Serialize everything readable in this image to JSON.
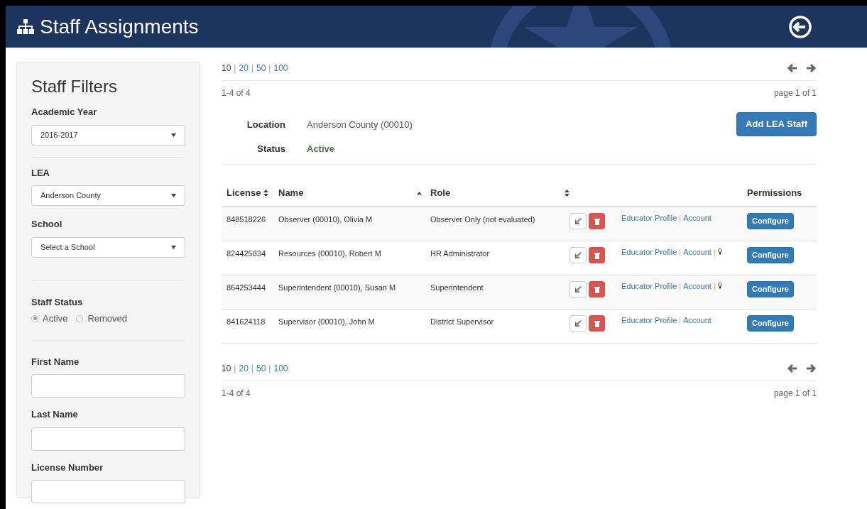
{
  "header": {
    "title": "Staff Assignments"
  },
  "filters": {
    "title": "Staff Filters",
    "selects": [
      {
        "label": "Academic Year",
        "value": "2016-2017",
        "divider": true
      },
      {
        "label": "LEA",
        "value": "Anderson County",
        "divider": false
      },
      {
        "label": "School",
        "value": "Select a School",
        "divider": true
      }
    ],
    "status": {
      "label": "Staff Status",
      "options": [
        {
          "label": "Active",
          "selected": true
        },
        {
          "label": "Removed",
          "selected": false
        }
      ]
    },
    "fields": [
      {
        "label": "First Name"
      },
      {
        "label": "Last Name"
      },
      {
        "label": "License Number"
      }
    ]
  },
  "pager_top": {
    "separator": "|",
    "sizes": [
      {
        "label": "10",
        "selected": true
      },
      {
        "label": "20",
        "selected": false
      },
      {
        "label": "50",
        "selected": false
      },
      {
        "label": "100",
        "selected": false
      }
    ],
    "range": "1-4 of 4",
    "page": "page 1 of 1"
  },
  "info": [
    {
      "label": "Location",
      "value": "Anderson County (00010)",
      "kind": "plain"
    },
    {
      "label": "Status",
      "value": "Active",
      "kind": "status"
    }
  ],
  "add_button": "Add LEA Staff",
  "table": {
    "columns": [
      {
        "label": "License",
        "kind": "both"
      },
      {
        "label": "Name",
        "kind": "asc"
      },
      {
        "label": "Role",
        "kind": "both"
      },
      {
        "label": "Permissions",
        "kind": "none"
      }
    ],
    "rows": [
      {
        "license": "848518226",
        "name": "Observer (00010), Olivia M",
        "role": "Observer Only (not evaluated)",
        "links": [
          {
            "kind": "link",
            "text": "Educator Profile"
          },
          {
            "kind": "sep",
            "text": "|"
          },
          {
            "kind": "link",
            "text": "Account"
          }
        ],
        "button": "Configure"
      },
      {
        "license": "824425834",
        "name": "Resources (00010), Robert M",
        "role": "HR Administrator",
        "links": [
          {
            "kind": "link",
            "text": "Educator Profile"
          },
          {
            "kind": "sep",
            "text": "|"
          },
          {
            "kind": "link",
            "text": "Account"
          },
          {
            "kind": "sep",
            "text": "|"
          },
          {
            "kind": "bulb"
          }
        ],
        "button": "Configure"
      },
      {
        "license": "864253444",
        "name": "Superintendent (00010), Susan M",
        "role": "Superintendent",
        "links": [
          {
            "kind": "link",
            "text": "Educator Profile"
          },
          {
            "kind": "sep",
            "text": "|"
          },
          {
            "kind": "link",
            "text": "Account"
          },
          {
            "kind": "sep",
            "text": "|"
          },
          {
            "kind": "bulb"
          }
        ],
        "button": "Configure"
      },
      {
        "license": "841624118",
        "name": "Supervisor (00010), John M",
        "role": "District Supervisor",
        "links": [
          {
            "kind": "link",
            "text": "Educator Profile"
          },
          {
            "kind": "sep",
            "text": "|"
          },
          {
            "kind": "link",
            "text": "Account"
          }
        ],
        "button": "Configure"
      }
    ]
  },
  "pager_bottom": {
    "separator": "|",
    "sizes": [
      {
        "label": "10",
        "selected": true
      },
      {
        "label": "20",
        "selected": false
      },
      {
        "label": "50",
        "selected": false
      },
      {
        "label": "100",
        "selected": false
      }
    ],
    "range": "1-4 of 4",
    "page": "page 1 of 1"
  }
}
